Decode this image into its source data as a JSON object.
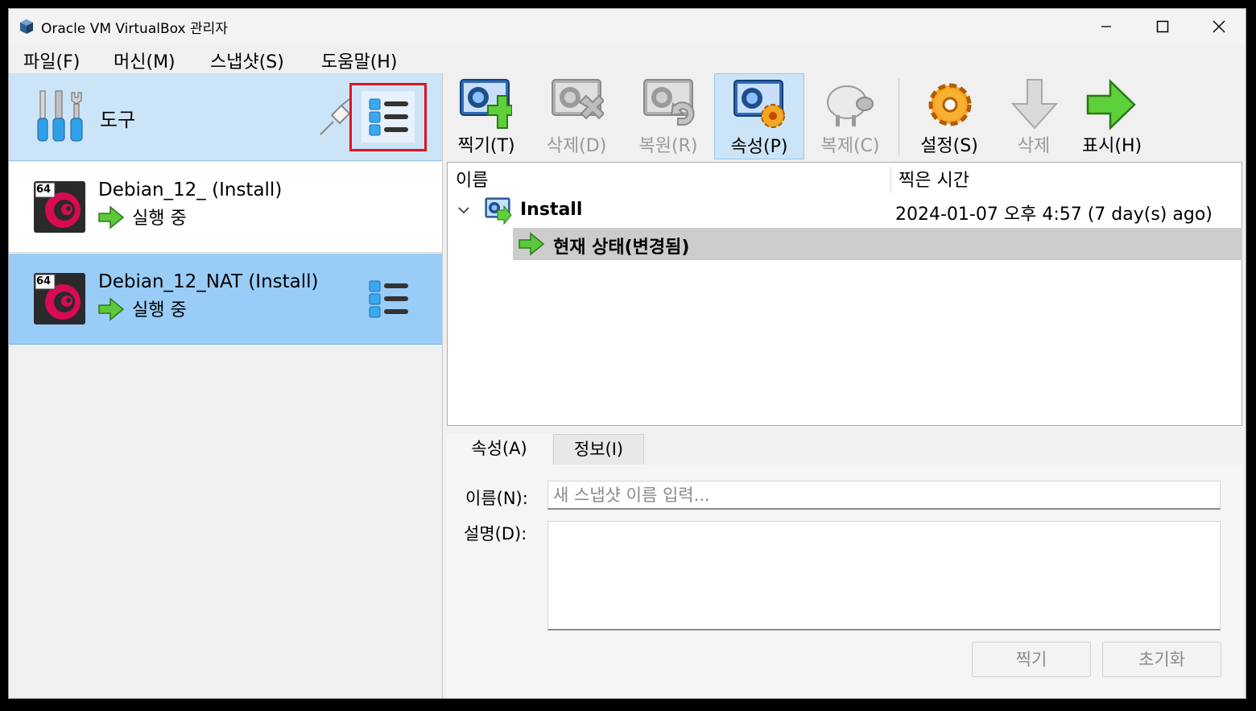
{
  "window": {
    "title": "Oracle VM VirtualBox 관리자"
  },
  "menu": [
    "파일(F)",
    "머신(M)",
    "스냅샷(S)",
    "도움말(H)"
  ],
  "tools": {
    "label": "도구"
  },
  "vms": [
    {
      "name": "Debian_12_",
      "snapshot": "(Install)",
      "state": "실행 중",
      "badge": "64"
    },
    {
      "name": "Debian_12_NAT",
      "snapshot": "(Install)",
      "state": "실행 중",
      "badge": "64"
    }
  ],
  "toolbar": {
    "take": "찍기(T)",
    "delete": "삭제(D)",
    "restore": "복원(R)",
    "properties": "속성(P)",
    "clone": "복제(C)",
    "settings": "설정(S)",
    "discard": "삭제",
    "show": "표시(H)"
  },
  "tree": {
    "col_name": "이름",
    "col_time": "찍은 시간",
    "snapshot_name": "Install",
    "snapshot_time": "2024-01-07 오후 4:57 (7 day(s) ago)",
    "current_state": "현재 상태(변경됨)"
  },
  "details": {
    "tab_properties": "속성(A)",
    "tab_info": "정보(I)",
    "name_label": "이름(N):",
    "name_placeholder": "새 스냅샷 이름 입력...",
    "desc_label": "설명(D):",
    "take_button": "찍기",
    "reset_button": "초기화"
  },
  "colors": {
    "selection": "#99ccf7",
    "tools_bg": "#cce4f7",
    "highlight": "#e0141e"
  }
}
